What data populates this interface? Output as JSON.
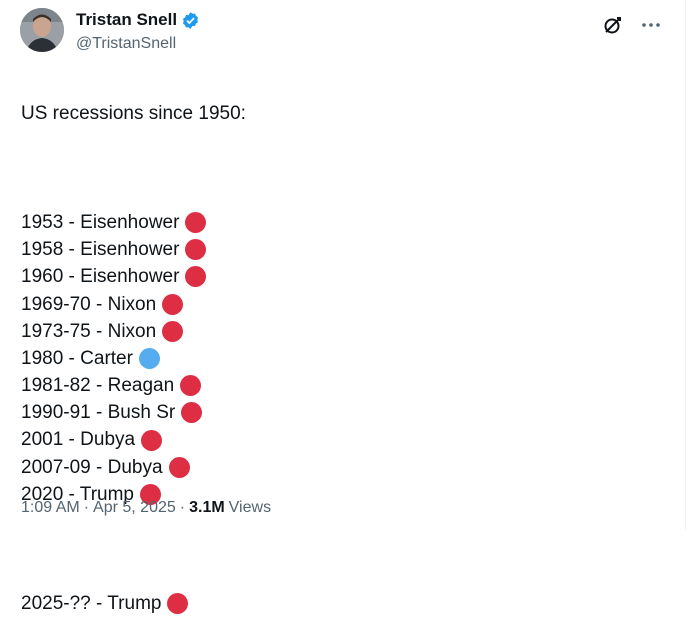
{
  "author": {
    "display_name": "Tristan Snell",
    "handle": "@TristanSnell",
    "verified_icon": "verified-badge-icon"
  },
  "actions": {
    "grok_icon": "grok-icon",
    "more_icon": "more-icon"
  },
  "tweet": {
    "intro": "US recessions since 1950:",
    "lines": [
      {
        "text": "1953 - Eisenhower",
        "dot": "red"
      },
      {
        "text": "1958 - Eisenhower",
        "dot": "red"
      },
      {
        "text": "1960 - Eisenhower",
        "dot": "red"
      },
      {
        "text": "1969-70 - Nixon",
        "dot": "red"
      },
      {
        "text": "1973-75 - Nixon",
        "dot": "red"
      },
      {
        "text": "1980 - Carter",
        "dot": "blue"
      },
      {
        "text": "1981-82 - Reagan",
        "dot": "red"
      },
      {
        "text": "1990-91 - Bush Sr",
        "dot": "red"
      },
      {
        "text": "2001 - Dubya",
        "dot": "red"
      },
      {
        "text": "2007-09 - Dubya",
        "dot": "red"
      },
      {
        "text": "2020 - Trump",
        "dot": "red"
      }
    ],
    "final_line": {
      "text": "2025-?? - Trump",
      "dot": "red"
    }
  },
  "meta": {
    "time": "1:09 AM",
    "separator": "·",
    "date": "Apr 5, 2025",
    "views_count": "3.1M",
    "views_label": "Views"
  },
  "colors": {
    "red": "#dd2e44",
    "blue": "#55acee",
    "verified": "#1d9bf0"
  }
}
